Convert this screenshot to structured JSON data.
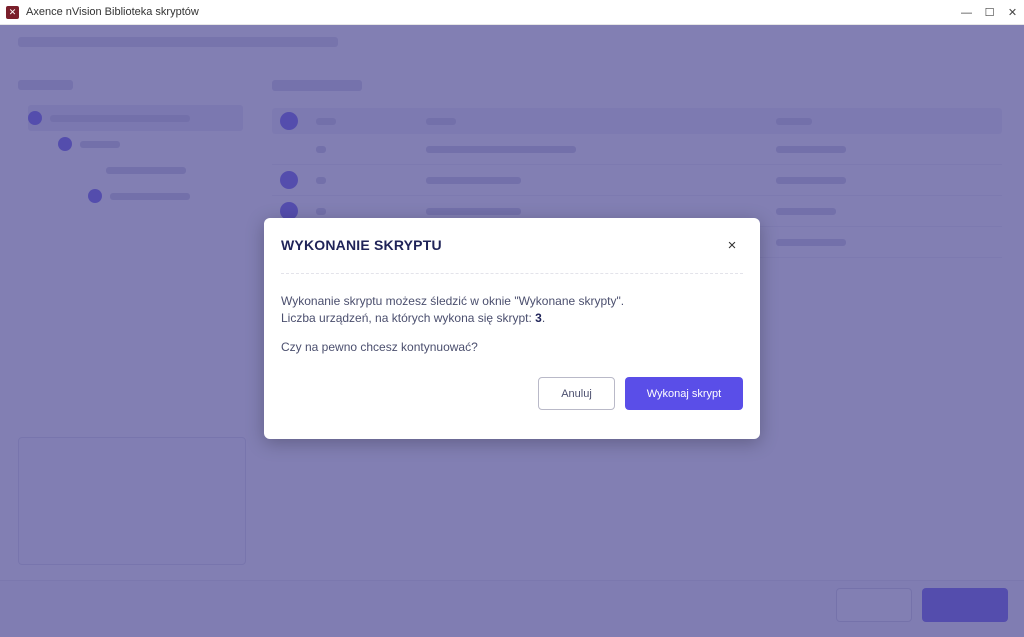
{
  "window": {
    "title": "Axence nVision Biblioteka skryptów",
    "minimize_glyph": "—",
    "maximize_glyph": "☐",
    "close_glyph": "✕",
    "app_icon_glyph": "✕"
  },
  "modal": {
    "title": "WYKONANIE SKRYPTU",
    "close_glyph": "×",
    "line1": "Wykonanie skryptu możesz śledzić w oknie \"Wykonane skrypty\".",
    "line2_prefix": "Liczba urządzeń, na których wykona się skrypt: ",
    "device_count": "3",
    "line2_suffix": ".",
    "question": "Czy na pewno chcesz kontynuować?",
    "cancel_label": "Anuluj",
    "confirm_label": "Wykonaj skrypt"
  },
  "colors": {
    "accent": "#5a4ee8",
    "overlay": "#524e96",
    "title_text": "#1f2358"
  }
}
